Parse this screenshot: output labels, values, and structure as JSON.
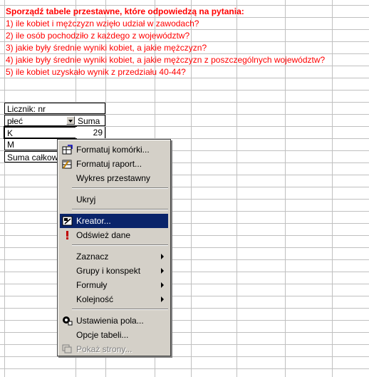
{
  "instructions": {
    "title": "Sporządź tabele przestawne, które odpowiedzą na pytania:",
    "questions": [
      "1) ile kobiet i mężczyzn wzięło udział w zawodach?",
      "2) ile osób pochodziło z każdego z województw?",
      "3) jakie były średnie wyniki kobiet, a jakie mężczyzn?",
      "4) jakie były średnie wyniki kobiet, a jakie mężczyzn z poszczególnych województw?",
      "5) ile kobiet uzyskało wynik z przedziału 40-44?"
    ]
  },
  "pivot": {
    "data_field": "Licznik: nr",
    "row_field": "płeć",
    "sum_header": "Suma",
    "rows": [
      {
        "label": "K",
        "value": "29"
      },
      {
        "label": "M",
        "value": ""
      }
    ],
    "total_label": "Suma całkowita"
  },
  "context_menu": {
    "items": [
      {
        "id": "format-cells",
        "label": "Formatuj komórki...",
        "accel": "o",
        "icon": "format-cells-icon"
      },
      {
        "id": "format-report",
        "label": "Formatuj raport...",
        "accel": "u",
        "icon": "format-report-icon"
      },
      {
        "id": "pivot-chart",
        "label": "Wykres przestawny",
        "accel": "W"
      },
      {
        "id": "hide",
        "label": "Ukryj",
        "accel": "U"
      },
      {
        "id": "wizard",
        "label": "Kreator...",
        "accel": "K",
        "icon": "wizard-icon",
        "highlighted": true
      },
      {
        "id": "refresh",
        "label": "Odśwież dane",
        "icon": "refresh-exclamation-icon"
      },
      {
        "id": "select",
        "label": "Zaznacz",
        "accel": "Z",
        "submenu": true
      },
      {
        "id": "group",
        "label": "Grupy i konspekt",
        "accel": "G",
        "submenu": true
      },
      {
        "id": "formulas",
        "label": "Formuły",
        "accel": "y",
        "submenu": true
      },
      {
        "id": "order",
        "label": "Kolejność",
        "accel": "K",
        "submenu": true
      },
      {
        "id": "field-settings",
        "label": "Ustawienia pola...",
        "accel": "p",
        "icon": "field-settings-icon"
      },
      {
        "id": "table-options",
        "label": "Opcje tabeli...",
        "accel": "O"
      },
      {
        "id": "show-pages",
        "label": "Pokaż strony...",
        "accel": "s",
        "icon": "show-pages-icon",
        "disabled": true
      }
    ]
  },
  "colors": {
    "instruction_text": "#ff0000",
    "menu_background": "#d4d0c8",
    "menu_highlight": "#0a246a",
    "gridlines": "#c0c0c0"
  }
}
